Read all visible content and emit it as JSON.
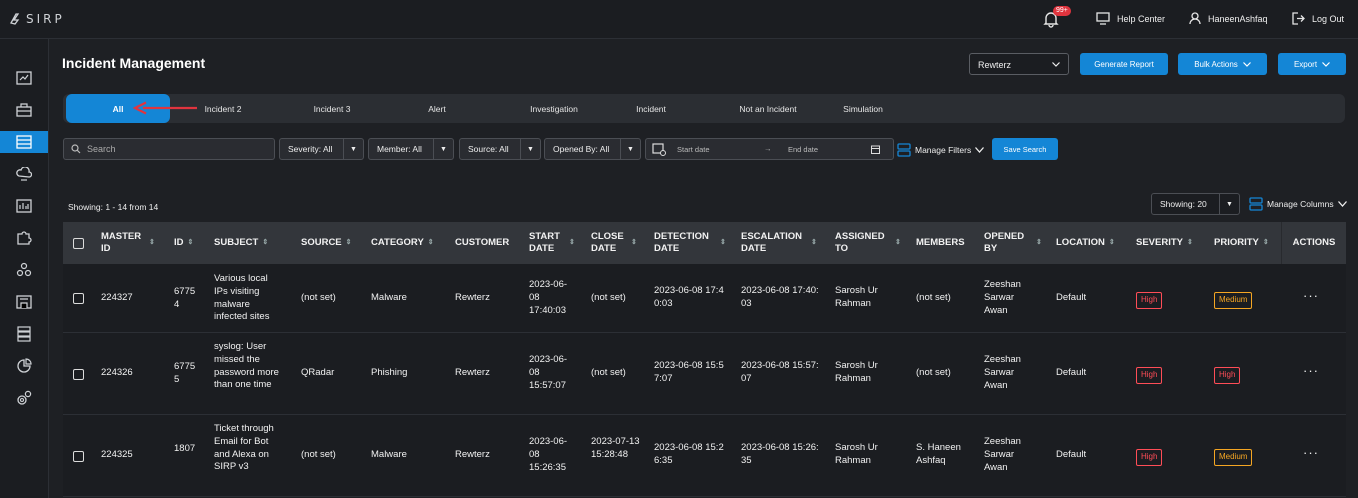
{
  "brand": {
    "name": "SIRP"
  },
  "topbar": {
    "notification_badge": "99+",
    "help_center": "Help Center",
    "user_name": "HaneenAshfaq",
    "logout": "Log Out"
  },
  "header": {
    "title": "Incident Management",
    "org_select": "Rewterz",
    "generate_report": "Generate Report",
    "bulk_actions": "Bulk Actions",
    "export": "Export"
  },
  "tabs": [
    {
      "label": "All",
      "active": true
    },
    {
      "label": "Incident 2"
    },
    {
      "label": "Incident 3"
    },
    {
      "label": "Alert"
    },
    {
      "label": "Investigation"
    },
    {
      "label": "Incident"
    },
    {
      "label": "Not an Incident"
    },
    {
      "label": "Simulation"
    }
  ],
  "filters": {
    "search_placeholder": "Search",
    "severity": "Severity: All",
    "member": "Member: All",
    "source": "Source: All",
    "opened_by": "Opened By: All",
    "start_date": "Start date",
    "end_date": "End date",
    "date_sep": "→",
    "manage_filters": "Manage Filters",
    "save_search": "Save Search"
  },
  "listing": {
    "showing_info": "Showing: 1 - 14 from 14",
    "page_size": "Showing: 20",
    "manage_columns": "Manage Columns"
  },
  "table": {
    "columns": [
      "MASTER ID",
      "ID",
      "SUBJECT",
      "SOURCE",
      "CATEGORY",
      "CUSTOMER",
      "START DATE",
      "CLOSE DATE",
      "DETECTION DATE",
      "ESCALATION DATE",
      "ASSIGNED TO",
      "MEMBERS",
      "OPENED BY",
      "LOCATION",
      "SEVERITY",
      "PRIORITY",
      "ACTIONS"
    ],
    "rows": [
      {
        "master_id": "224327",
        "id": "67754",
        "subject": "Various local IPs visiting malware infected sites",
        "source": "(not set)",
        "category": "Malware",
        "customer": "Rewterz",
        "start_date": "2023-06-08 17:40:03",
        "close_date": "(not set)",
        "detection_date": "2023-06-08 17:40:03",
        "escalation_date": "2023-06-08 17:40:03",
        "assigned_to": "Sarosh Ur Rahman",
        "members": "(not set)",
        "opened_by": "Zeeshan Sarwar Awan",
        "location": "Default",
        "severity": "High",
        "priority": "Medium",
        "actions": "···"
      },
      {
        "master_id": "224326",
        "id": "67755",
        "subject": "syslog: User missed the password more than one time",
        "source": "QRadar",
        "category": "Phishing",
        "customer": "Rewterz",
        "start_date": "2023-06-08 15:57:07",
        "close_date": "(not set)",
        "detection_date": "2023-06-08 15:57:07",
        "escalation_date": "2023-06-08 15:57:07",
        "assigned_to": "Sarosh Ur Rahman",
        "members": "(not set)",
        "opened_by": "Zeeshan Sarwar Awan",
        "location": "Default",
        "severity": "High",
        "priority": "High",
        "actions": "···"
      },
      {
        "master_id": "224325",
        "id": "1807",
        "subject": "Ticket through Email for Bot and Alexa on SIRP v3",
        "source": "(not set)",
        "category": "Malware",
        "customer": "Rewterz",
        "start_date": "2023-06-08 15:26:35",
        "close_date": "2023-07-13 15:28:48",
        "detection_date": "2023-06-08 15:26:35",
        "escalation_date": "2023-06-08 15:26:35",
        "assigned_to": "Sarosh Ur Rahman",
        "members": "S. Haneen Ashfaq",
        "opened_by": "Zeeshan Sarwar Awan",
        "location": "Default",
        "severity": "High",
        "priority": "Medium",
        "actions": "···"
      }
    ]
  },
  "colors": {
    "accent": "#1486d6",
    "high": "#ff4d57",
    "medium": "#f5a623",
    "arrow": "#e0343e"
  }
}
